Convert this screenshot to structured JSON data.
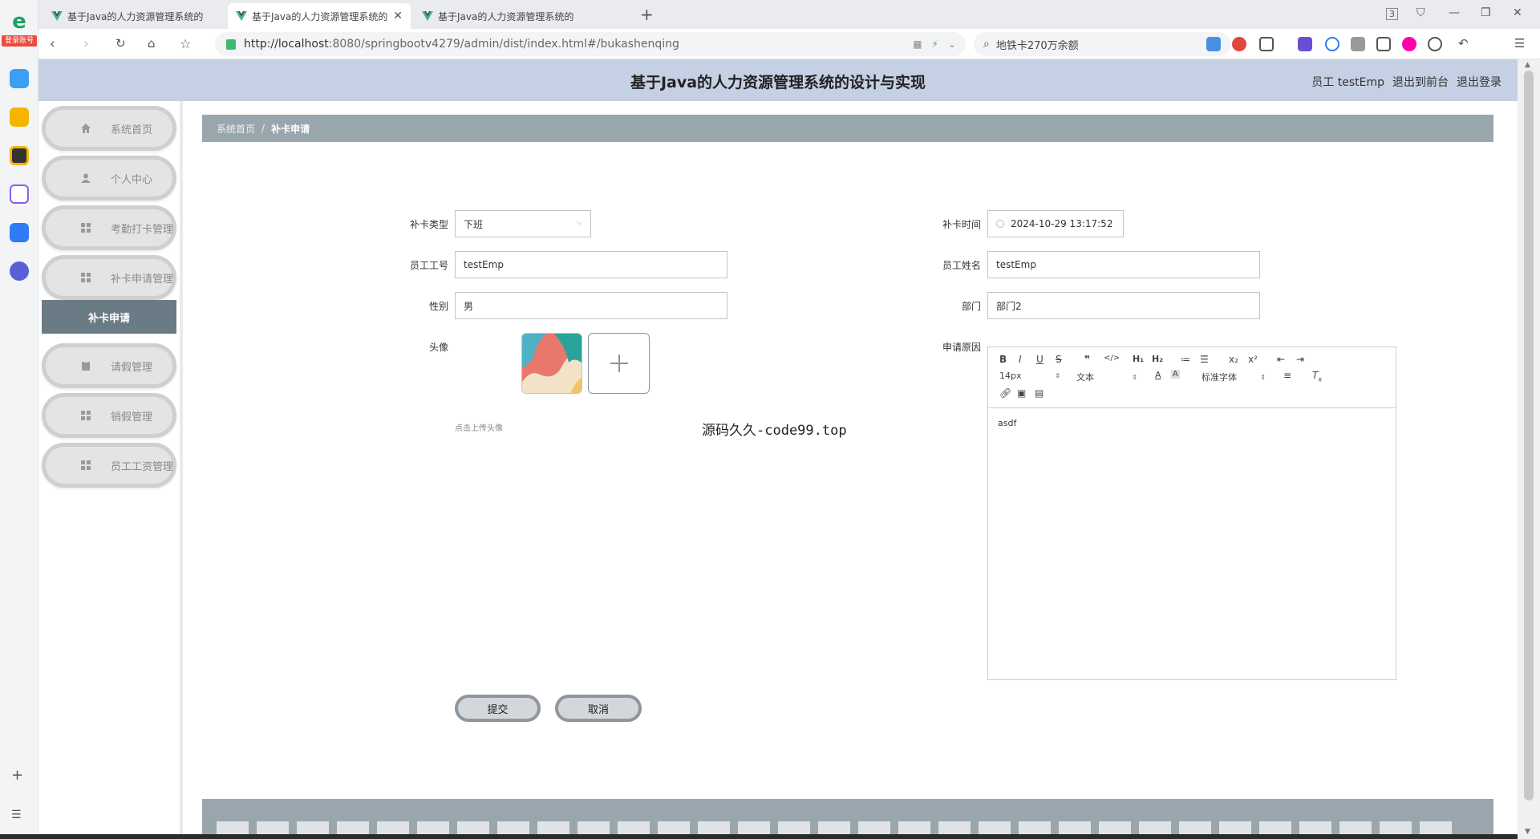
{
  "browser": {
    "tabs": [
      {
        "title": "基于Java的人力资源管理系统的",
        "active": false
      },
      {
        "title": "基于Java的人力资源管理系统的",
        "active": true
      },
      {
        "title": "基于Java的人力资源管理系统的",
        "active": false
      }
    ],
    "tab_count_badge": "3",
    "url_host": "http://localhost",
    "url_rest": ":8080/springbootv4279/admin/dist/index.html#/bukashenqing",
    "search_text": "地铁卡270万余额",
    "login_badge": "登录账号"
  },
  "header": {
    "title": "基于Java的人力资源管理系统的设计与实现",
    "user_label": "员工 testEmp",
    "back_to_front": "退出到前台",
    "logout": "退出登录"
  },
  "sidebar": {
    "items": [
      {
        "label": "系统首页",
        "icon": "home-icon"
      },
      {
        "label": "个人中心",
        "icon": "user-icon"
      },
      {
        "label": "考勤打卡管理",
        "icon": "grid-icon"
      },
      {
        "label": "补卡申请管理",
        "icon": "grid-icon"
      },
      {
        "label": "请假管理",
        "icon": "clipboard-icon"
      },
      {
        "label": "销假管理",
        "icon": "grid-icon"
      },
      {
        "label": "员工工资管理",
        "icon": "grid-icon"
      }
    ],
    "active_submenu": "补卡申请"
  },
  "breadcrumb": {
    "home": "系统首页",
    "separator": "/",
    "current": "补卡申请"
  },
  "form": {
    "type_label": "补卡类型",
    "type_value": "下班",
    "time_label": "补卡时间",
    "time_value": "2024-10-29 13:17:52",
    "emp_no_label": "员工工号",
    "emp_no_value": "testEmp",
    "emp_name_label": "员工姓名",
    "emp_name_value": "testEmp",
    "gender_label": "性别",
    "gender_value": "男",
    "dept_label": "部门",
    "dept_value": "部门2",
    "avatar_label": "头像",
    "upload_tip": "点击上传头像",
    "reason_label": "申请原因",
    "reason_value": "asdf",
    "submit": "提交",
    "cancel": "取消"
  },
  "editor": {
    "font_size": "14px",
    "block_type": "文本",
    "font_family": "标准字体"
  },
  "watermark": "源码久久-code99.top",
  "colors": {
    "header_bg": "#c5d0e4",
    "breadcrumb_bg": "#9aa6ad",
    "submenu_bg": "#6b7b86"
  }
}
